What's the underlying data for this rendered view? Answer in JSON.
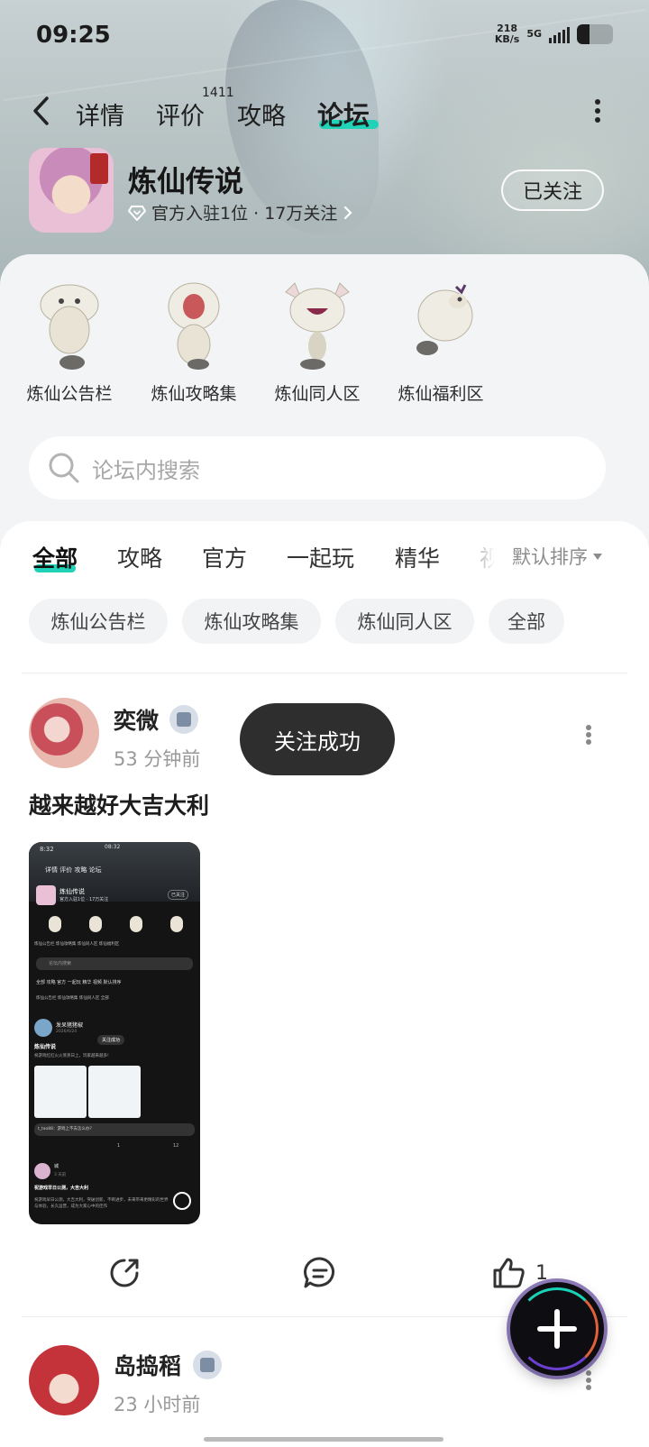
{
  "status": {
    "time": "09:25",
    "speed_value": "218",
    "speed_unit": "KB/s",
    "network": "5G",
    "battery_level": 0.35
  },
  "nav": {
    "tabs": [
      {
        "label": "详情"
      },
      {
        "label": "评价",
        "badge": "1411"
      },
      {
        "label": "攻略"
      },
      {
        "label": "论坛"
      }
    ],
    "active_tab": "论坛"
  },
  "game": {
    "name": "炼仙传说",
    "subtitle": "官方入驻1位 · 17万关注",
    "follow_label": "已关注"
  },
  "shortcuts": [
    {
      "label": "炼仙公告栏"
    },
    {
      "label": "炼仙攻略集"
    },
    {
      "label": "炼仙同人区"
    },
    {
      "label": "炼仙福利区"
    }
  ],
  "search": {
    "placeholder": "论坛内搜索"
  },
  "content_tabs": [
    "全部",
    "攻略",
    "官方",
    "一起玩",
    "精华",
    "视"
  ],
  "sort_label": "默认排序",
  "chips": [
    "炼仙公告栏",
    "炼仙攻略集",
    "炼仙同人区",
    "全部"
  ],
  "toast": "关注成功",
  "posts": [
    {
      "user": "奕微",
      "time": "53 分钟前",
      "title": "越来越好大吉大利",
      "likes": "1"
    },
    {
      "user": "岛捣稻",
      "time": "23 小时前"
    }
  ],
  "screenshot_thumb": {
    "time_left": "8:32",
    "time_center": "08:32",
    "tabs": "详情 评价 攻略 论坛",
    "game_name": "炼仙传说",
    "game_sub": "官方入驻1位 · 17万关注",
    "follow": "已关注",
    "shortcuts": "炼仙公告栏 炼仙攻略集 炼仙同人区 炼仙福利区",
    "search": "论坛内搜索",
    "tabs2": "全部 攻略 官方 一起玩 精华 视频 默认排序",
    "chips": "炼仙公告栏 炼仙攻略集 炼仙同人区 全部",
    "post_user": "发呆猪猪椒",
    "post_date": "2026/6/24",
    "post_title": "炼仙传说",
    "post_body": "祝游戏红红火火蒸蒸日上，玩家越来越多!",
    "toast": "关注成功",
    "comment": "t_tao88：游戏上不去怎么办?",
    "c1": "1",
    "c2": "12",
    "post2_user": "城",
    "post2_time": "3 天前",
    "post2_title": "祝游戏早日公测，大吉大利",
    "post2_body": "祝游戏早日公测，大吉大利，突破创新，不断进步，未来带来更精彩的世界与体验，长久运营，成为大家心中的佳作"
  },
  "colors": {
    "accent": "#20d2b8",
    "toast_bg": "#2e2e2e",
    "sheet_bg": "#f3f4f6"
  }
}
